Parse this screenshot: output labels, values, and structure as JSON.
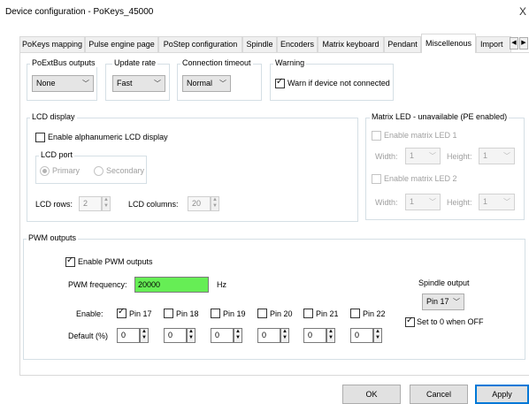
{
  "window": {
    "title": "Device configuration - PoKeys_45000",
    "close_glyph": "X"
  },
  "tabs": [
    {
      "label": "PoKeys mapping"
    },
    {
      "label": "Pulse engine page"
    },
    {
      "label": "PoStep configuration"
    },
    {
      "label": "Spindle"
    },
    {
      "label": "Encoders"
    },
    {
      "label": "Matrix keyboard"
    },
    {
      "label": "Pendant"
    },
    {
      "label": "Miscellenous"
    },
    {
      "label": "Import"
    }
  ],
  "tab_scroll": {
    "left": "◀",
    "right": "▶"
  },
  "poextbus": {
    "label": "PoExtBus outputs",
    "value": "None"
  },
  "update_rate": {
    "label": "Update rate",
    "value": "Fast"
  },
  "conn_timeout": {
    "label": "Connection timeout",
    "value": "Normal"
  },
  "warning": {
    "label": "Warning",
    "checkbox_label": "Warn if device not connected",
    "checked": true
  },
  "lcd": {
    "label": "LCD display",
    "enable_label": "Enable alphanumeric LCD display",
    "port_label": "LCD port",
    "primary": "Primary",
    "secondary": "Secondary",
    "rows_label": "LCD rows:",
    "rows_value": "2",
    "cols_label": "LCD columns:",
    "cols_value": "20"
  },
  "matrix_led": {
    "label": "Matrix LED - unavailable (PE enabled)",
    "led1_label": "Enable matrix LED 1",
    "led2_label": "Enable matrix LED 2",
    "width_label": "Width:",
    "height_label": "Height:",
    "led1_width": "1",
    "led1_height": "1",
    "led2_width": "1",
    "led2_height": "1"
  },
  "pwm": {
    "label": "PWM outputs",
    "enable_label": "Enable PWM outputs",
    "freq_label": "PWM frequency:",
    "freq_value": "20000",
    "freq_unit": "Hz",
    "freq_color": "#66ee55",
    "enable_row_label": "Enable:",
    "default_row_label": "Default (%)",
    "pins": [
      {
        "label": "Pin 17",
        "checked": true,
        "default": "0"
      },
      {
        "label": "Pin 18",
        "checked": false,
        "default": "0"
      },
      {
        "label": "Pin 19",
        "checked": false,
        "default": "0"
      },
      {
        "label": "Pin 20",
        "checked": false,
        "default": "0"
      },
      {
        "label": "Pin 21",
        "checked": false,
        "default": "0"
      },
      {
        "label": "Pin 22",
        "checked": false,
        "default": "0"
      }
    ],
    "spindle_label": "Spindle output",
    "spindle_value": "Pin 17",
    "set_zero_label": "Set to 0 when OFF"
  },
  "buttons": {
    "ok": "OK",
    "cancel": "Cancel",
    "apply": "Apply"
  }
}
